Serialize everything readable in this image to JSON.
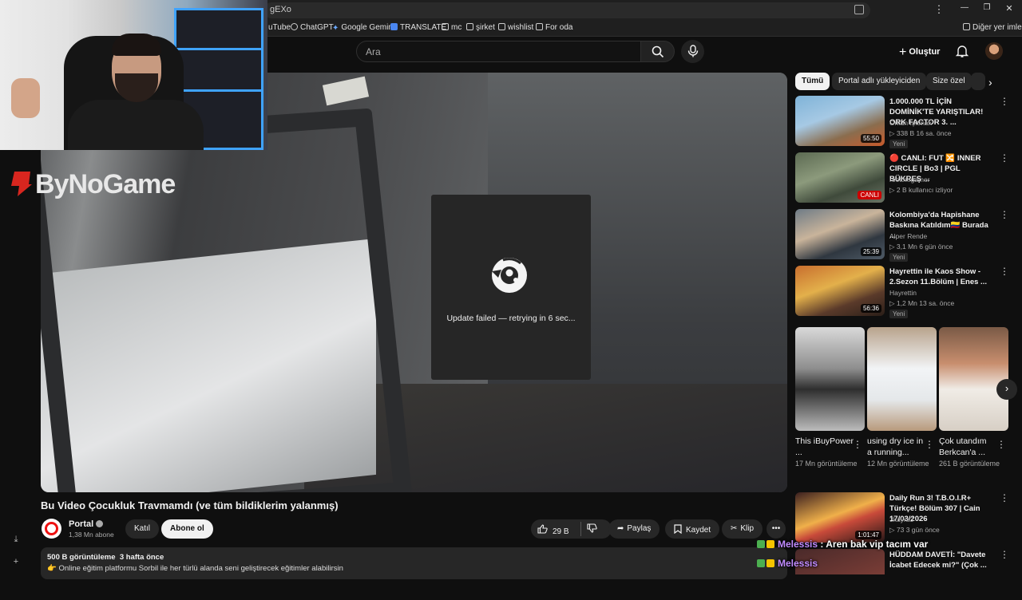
{
  "browser": {
    "address_text": "gEXo",
    "bookmarks": [
      {
        "label": "uTube",
        "icon": "youtube-icon"
      },
      {
        "label": "ChatGPT",
        "icon": "chatgpt-icon"
      },
      {
        "label": "Google Gemini",
        "icon": "gemini-icon"
      },
      {
        "label": "TRANSLATE",
        "icon": "translate-icon"
      },
      {
        "label": "mc",
        "icon": "folder-icon"
      },
      {
        "label": "şirket",
        "icon": "folder-icon"
      },
      {
        "label": "wishlist",
        "icon": "folder-icon"
      },
      {
        "label": "For oda",
        "icon": "folder-icon"
      }
    ],
    "other_bookmarks": "Diğer yer imleri",
    "window_buttons": [
      "⋮",
      "—",
      "❐",
      "✕"
    ]
  },
  "header": {
    "search_placeholder": "Ara",
    "create_label": "Oluştur"
  },
  "overlay": {
    "logo_text": "ByNoGame"
  },
  "player": {
    "error_message": "Update failed — retrying in 6 sec..."
  },
  "video": {
    "title": "Bu Video Çocukluk Travmamdı (ve tüm bildiklerim yalanmış)",
    "channel_name": "Portal",
    "subscribers": "1,38 Mn abone",
    "join_label": "Katıl",
    "subscribe_label": "Abone ol",
    "likes": "29 B",
    "share_label": "Paylaş",
    "save_label": "Kaydet",
    "clip_label": "Klip",
    "views": "500 B görüntüleme",
    "date": "3 hafta önce",
    "description": "👉 Online eğitim platformu Sorbil ile her türlü alanda seni geliştirecek eğitimler alabilirsin"
  },
  "sidebar": {
    "chips": [
      "Tümü",
      "Portal adlı yükleyiciden",
      "Size özel"
    ],
    "recommendations": [
      {
        "title": "1.000.000 TL İÇİN DOMİNİK'TE YARIŞTILAR! ORK FACTOR 3. ...",
        "channel": "Orkun Işıtmak",
        "meta": "338 B   16 sa. önce",
        "badge": "Yeni",
        "duration": "55:50"
      },
      {
        "title": "🔴 CANLI: FUT 🔀 INNER CIRCLE | Bo3 | PGL BÜKREŞ ...",
        "channel": "rootthegamer",
        "meta": "2 B kullanıcı izliyor",
        "badge": "",
        "duration": "CANLI"
      },
      {
        "title": "Kolombiya'da Hapishane Baskına Katıldım🇨🇴 Burada ...",
        "channel": "Alper Rende",
        "meta": "3,1 Mn   6 gün önce",
        "badge": "Yeni",
        "duration": "25:39"
      },
      {
        "title": "Hayrettin ile Kaos Show - 2.Sezon 11.Bölüm | Enes ...",
        "channel": "Hayrettin",
        "meta": "1,2 Mn   13 sa. önce",
        "badge": "Yeni",
        "duration": "56:36"
      }
    ],
    "shorts": [
      {
        "title": "This iBuyPower ...",
        "views": "17 Mn görüntüleme"
      },
      {
        "title": "using dry ice in a running...",
        "views": "12 Mn görüntüleme"
      },
      {
        "title": "Çok utandım Berkcan'a ...",
        "views": "261 B görüntüleme"
      }
    ],
    "bottom_recs": [
      {
        "title": "Daily Run 3! T.B.O.I.R+ Türkçe! Bölüm 307 | Cain 17/03/2026",
        "channel": "3kayra3",
        "meta": "73   3 gün önce",
        "duration": "1:01:47"
      },
      {
        "title": "HÜDDAM DAVETİ: \"Davete İcabet Edecek mi?\" (Çok ...",
        "channel": "",
        "meta": "",
        "duration": ""
      }
    ]
  },
  "chat": [
    {
      "user": "Melessis",
      "message": " : Aren bak vip tacım var"
    },
    {
      "user": "Melessis",
      "message": ""
    }
  ],
  "colors": {
    "accent_red": "#cc0000",
    "chat_name": "#c08bff",
    "webcam_led": "#3fa3ff"
  }
}
